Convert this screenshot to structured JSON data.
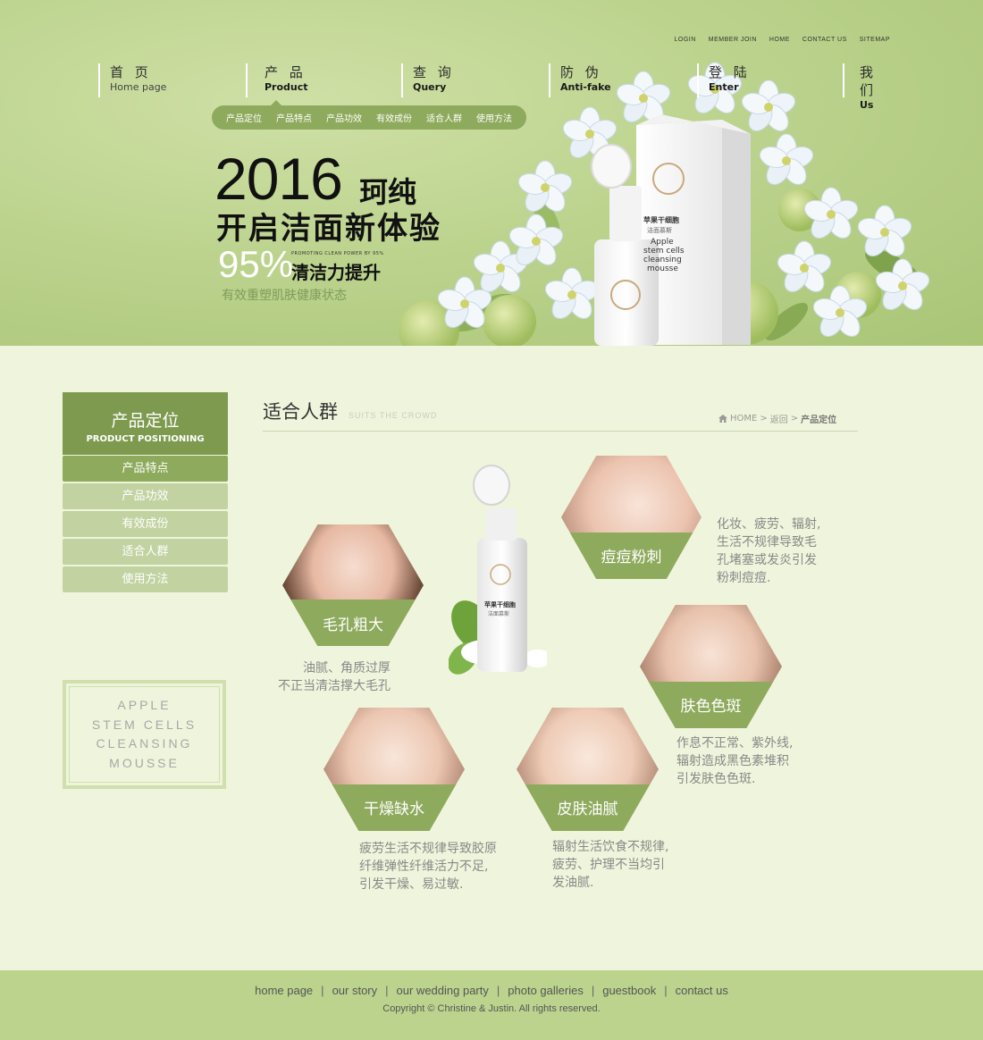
{
  "toplinks": [
    "LOGIN",
    "MEMBER JOIN",
    "HOME",
    "CONTACT US",
    "SITEMAP"
  ],
  "nav": [
    {
      "cn": "首 页",
      "en": "Home page"
    },
    {
      "cn": "产 品",
      "en": "Product"
    },
    {
      "cn": "查 询",
      "en": "Query"
    },
    {
      "cn": "防 伪",
      "en": "Anti-fake"
    },
    {
      "cn": "登 陆",
      "en": "Enter"
    },
    {
      "cn": "我 们",
      "en": "Us"
    }
  ],
  "subnav": [
    "产品定位",
    "产品特点",
    "产品功效",
    "有效成份",
    "适合人群",
    "使用方法"
  ],
  "hero": {
    "year": "2016",
    "brand": "珂纯",
    "line2": "开启洁面新体验",
    "pct": "95%",
    "small": "PROMOTING CLEAN POWER BY 95%",
    "line3": "清洁力提升",
    "line4": "有效重塑肌肤健康状态",
    "box_text": "苹果干细胞",
    "box_text2": "洁面慕斯",
    "box_en1": "Apple",
    "box_en2": "stem cells",
    "box_en3": "cleansing",
    "box_en4": "mousse"
  },
  "sidebar": {
    "head_cn": "产品定位",
    "head_en": "PRODUCT POSITIONING",
    "items": [
      "产品特点",
      "产品功效",
      "有效成份",
      "适合人群",
      "使用方法"
    ],
    "box_lines": [
      "APPLE",
      "STEM CELLS",
      "CLEANSING",
      "MOUSSE"
    ]
  },
  "main": {
    "title": "适合人群",
    "subtitle": "SUITS THE CROWD",
    "breadcrumb": {
      "home": "HOME",
      "sep": ">",
      "back": "返回",
      "current": "产品定位"
    },
    "cards": [
      {
        "label": "毛孔粗大",
        "desc": [
          "油腻、角质过厚",
          "不正当清洁撑大毛孔"
        ]
      },
      {
        "label": "痘痘粉刺",
        "desc": [
          "化妆、疲劳、辐射,",
          "生活不规律导致毛",
          "孔堵塞或发炎引发",
          "粉刺痘痘."
        ]
      },
      {
        "label": "肤色色斑",
        "desc": [
          "作息不正常、紫外线,",
          "辐射造成黑色素堆积",
          "引发肤色色斑."
        ]
      },
      {
        "label": "干燥缺水",
        "desc": [
          "疲劳生活不规律导致胶原",
          "纤维弹性纤维活力不足,",
          "引发干燥、易过敏."
        ]
      },
      {
        "label": "皮肤油腻",
        "desc": [
          "辐射生活饮食不规律,",
          "疲劳、护理不当均引",
          "发油腻."
        ]
      }
    ],
    "bottle_text1": "苹果干细胞",
    "bottle_text2": "洁面慕斯"
  },
  "footer": {
    "links": [
      "home page",
      "our story",
      "our wedding party",
      "photo galleries",
      "guestbook",
      "contact us"
    ],
    "copyright": "Copyright © Christine & Justin. All rights reserved."
  },
  "colors": {
    "accent": "#8eaa5c",
    "accent_dark": "#7d9a4f",
    "accent_light": "#c2d3a1",
    "page_bg": "#eff5dc",
    "banner_bg": "#bcd38e"
  }
}
